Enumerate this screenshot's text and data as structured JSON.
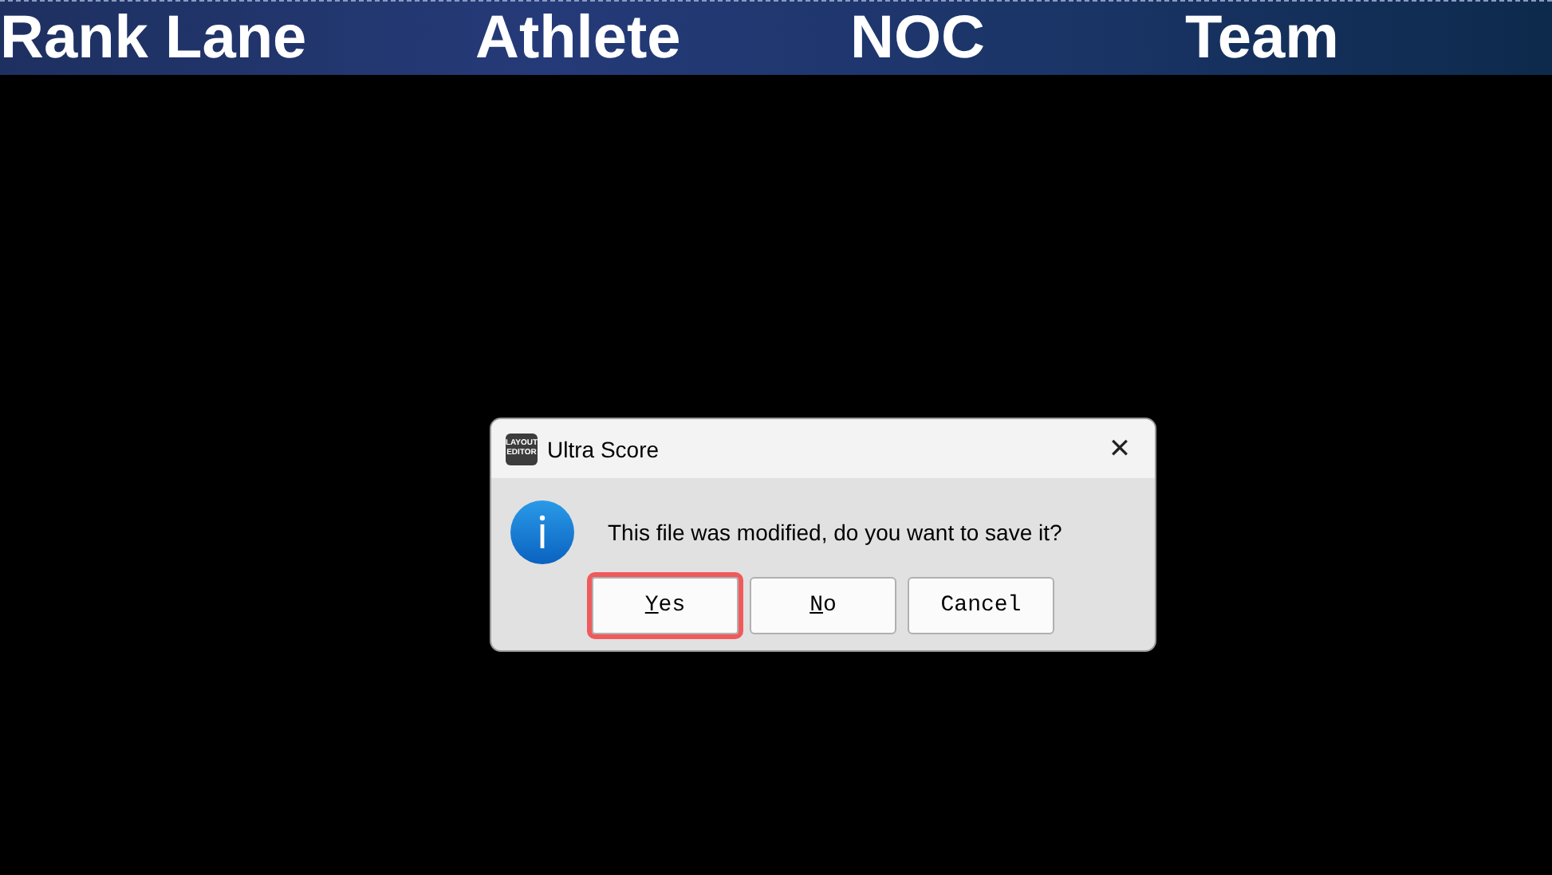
{
  "header": {
    "columns": [
      "Rank Lane",
      "Athlete",
      "NOC",
      "Team"
    ]
  },
  "dialog": {
    "app_icon_text": [
      "LAYOUT",
      "EDITOR"
    ],
    "title": "Ultra Score",
    "close": "✕",
    "message": "This file was modified, do you want to save it?",
    "buttons": [
      {
        "label": "Yes",
        "underline_first": true,
        "selected": true
      },
      {
        "label": "No",
        "underline_first": true,
        "selected": false
      },
      {
        "label": "Cancel",
        "underline_first": false,
        "selected": false
      }
    ]
  }
}
